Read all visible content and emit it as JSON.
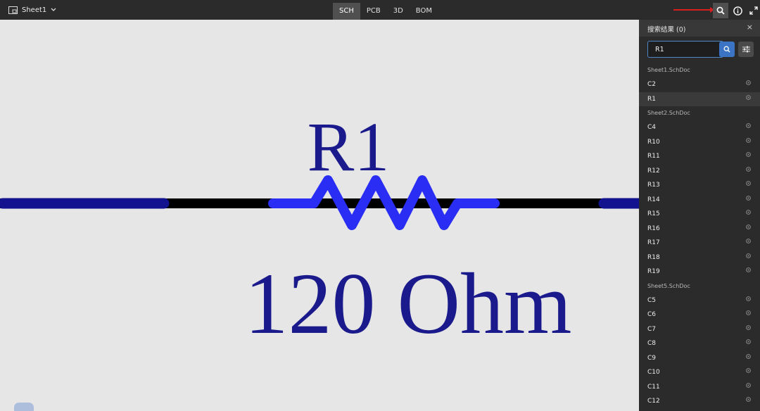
{
  "topbar": {
    "sheet_label": "Sheet1",
    "tabs": [
      {
        "label": "SCH",
        "active": true
      },
      {
        "label": "PCB",
        "active": false
      },
      {
        "label": "3D",
        "active": false
      },
      {
        "label": "BOM",
        "active": false
      }
    ],
    "icons": [
      "search-icon",
      "info-icon",
      "fullscreen-icon"
    ],
    "annotation_color": "#d62020"
  },
  "schematic": {
    "designator": "R1",
    "value": "120 Ohm",
    "label_color": "#1a1a8c",
    "resistor_color": "#2a2ef5",
    "wire_color": "#13138f"
  },
  "search_panel": {
    "title": "搜索结果 (0)",
    "close_glyph": "×",
    "query": "R1",
    "groups": [
      {
        "sheet": "Sheet1.SchDoc",
        "items": [
          "C2",
          "R1"
        ]
      },
      {
        "sheet": "Sheet2.SchDoc",
        "items": [
          "C4",
          "R10",
          "R11",
          "R12",
          "R13",
          "R14",
          "R15",
          "R16",
          "R17",
          "R18",
          "R19"
        ]
      },
      {
        "sheet": "Sheet5.SchDoc",
        "items": [
          "C5",
          "C6",
          "C7",
          "C8",
          "C9",
          "C10",
          "C11",
          "C12"
        ]
      }
    ],
    "selected_item": "R1",
    "accent_color": "#3b74c4"
  }
}
